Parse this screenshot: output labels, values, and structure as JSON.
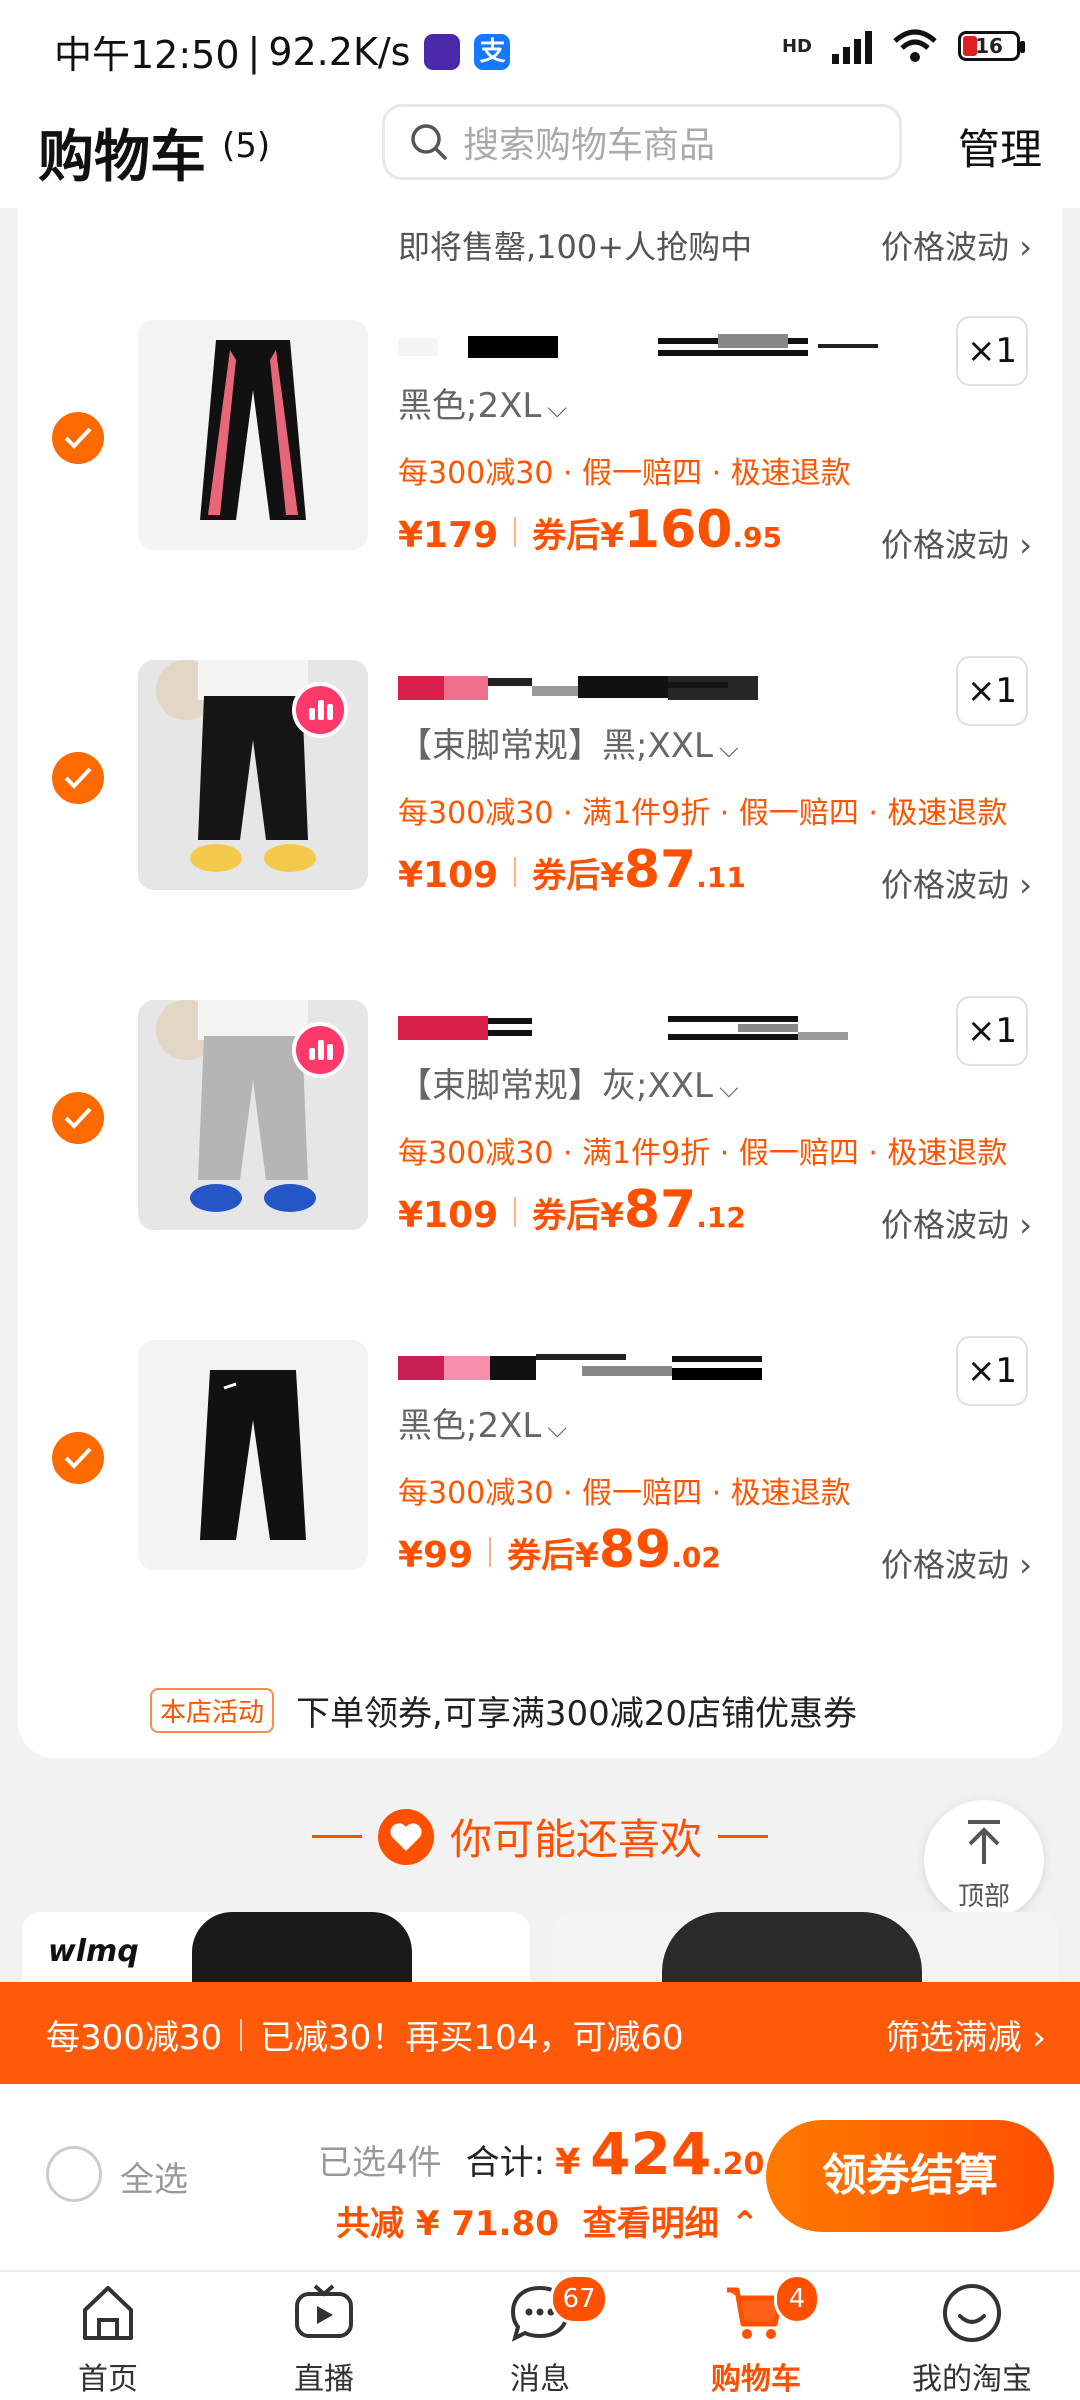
{
  "status_bar": {
    "time": "中午12:50",
    "speed": "92.2K/s",
    "battery": "16",
    "network": "HD"
  },
  "header": {
    "title": "购物车",
    "count": "(5)",
    "search_placeholder": "搜索购物车商品",
    "manage": "管理"
  },
  "top_partial": {
    "text": "即将售罄,100+人抢购中",
    "fluct": "价格波动"
  },
  "items": [
    {
      "sku": "黑色;2XL",
      "promo": "每300减30 · 假一赔四 · 极速退款",
      "qty": "×1",
      "orig": "¥179",
      "after_label": "券后",
      "cur": "¥",
      "big": "160",
      "small": ".95",
      "fluct": "价格波动",
      "thumb_color": "#111111",
      "accent": "#e8667a"
    },
    {
      "sku": "【束脚常规】黑;XXL",
      "promo": "每300减30 · 满1件9折 · 假一赔四 · 极速退款",
      "qty": "×1",
      "orig": "¥109",
      "after_label": "券后",
      "cur": "¥",
      "big": "87",
      "small": ".11",
      "fluct": "价格波动",
      "thumb_color": "#151515",
      "accent": "#f5c94a"
    },
    {
      "sku": "【束脚常规】灰;XXL",
      "promo": "每300减30 · 满1件9折 · 假一赔四 · 极速退款",
      "qty": "×1",
      "orig": "¥109",
      "after_label": "券后",
      "cur": "¥",
      "big": "87",
      "small": ".12",
      "fluct": "价格波动",
      "thumb_color": "#b5b5b5",
      "accent": "#2456c8"
    },
    {
      "sku": "黑色;2XL",
      "promo": "每300减30 · 假一赔四 · 极速退款",
      "qty": "×1",
      "orig": "¥99",
      "after_label": "券后",
      "cur": "¥",
      "big": "89",
      "small": ".02",
      "fluct": "价格波动",
      "thumb_color": "#111111",
      "accent": "#ffffff"
    }
  ],
  "shop_activity": {
    "tag": "本店活动",
    "text": "下单领券,可享满300减20店铺优惠券"
  },
  "recommend": {
    "title": "你可能还喜欢",
    "to_top": "顶部",
    "brand": "wlmq"
  },
  "promo_bar": {
    "rule": "每300减30",
    "message": "已减30！再买104，可减60",
    "filter": "筛选满减"
  },
  "settle": {
    "select_all": "全选",
    "selected": "已选4件",
    "total_label": "合计:",
    "cur": "¥",
    "big": "424",
    "small": ".20",
    "saved": "共减 ¥ 71.80",
    "detail": "查看明细",
    "pay": "领券结算"
  },
  "tabs": [
    {
      "label": "首页",
      "icon": "home-icon"
    },
    {
      "label": "直播",
      "icon": "live-play-icon"
    },
    {
      "label": "消息",
      "icon": "message-icon",
      "badge": "67"
    },
    {
      "label": "购物车",
      "icon": "cart-icon",
      "badge": "4",
      "active": true
    },
    {
      "label": "我的淘宝",
      "icon": "profile-icon"
    }
  ],
  "colors": {
    "accent": "#ff5000",
    "promo_bar": "#ff5a0a",
    "background": "#f2f2f2"
  }
}
